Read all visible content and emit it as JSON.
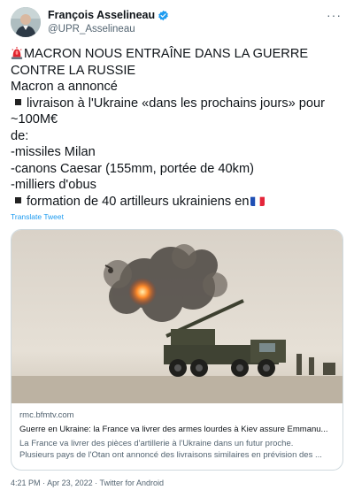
{
  "author": {
    "display_name": "François Asselineau",
    "handle": "@UPR_Asselineau",
    "avatar_icon": "person-photo-avatar",
    "verified_color": "#1d9bf0"
  },
  "menu_icon": "more-dots-icon",
  "tweet": {
    "headline_1": "MACRON NOUS ENTRAÎNE DANS LA GUERRE",
    "headline_2": "CONTRE LA RUSSIE",
    "line_3": "Macron a annoncé",
    "line_4": "livraison à l'Ukraine «dans les prochains jours» pour",
    "line_5": "~100M€",
    "line_6": "de:",
    "line_7": "-missiles Milan",
    "line_8": "-canons Caesar (155mm, portée de 40km)",
    "line_9": "-milliers d'obus",
    "line_10": "formation de 40 artilleurs ukrainiens en",
    "emoji_siren": "rotating-light-emoji",
    "emoji_flag": "france-flag-emoji"
  },
  "translate_label": "Translate Tweet",
  "card": {
    "image": "caesar-howitzer-firing-photo",
    "domain": "rmc.bfmtv.com",
    "title": "Guerre en Ukraine: la France va livrer des armes lourdes à Kiev assure Emmanu...",
    "desc_1": "La France va livrer des pièces d'artillerie à l'Ukraine dans un futur proche.",
    "desc_2": "Plusieurs pays de l'Otan ont annoncé des livraisons similaires en prévision des ..."
  },
  "meta": {
    "time": "4:21 PM",
    "date": "Apr 23, 2022",
    "source": "Twitter for Android",
    "separator": "·"
  }
}
